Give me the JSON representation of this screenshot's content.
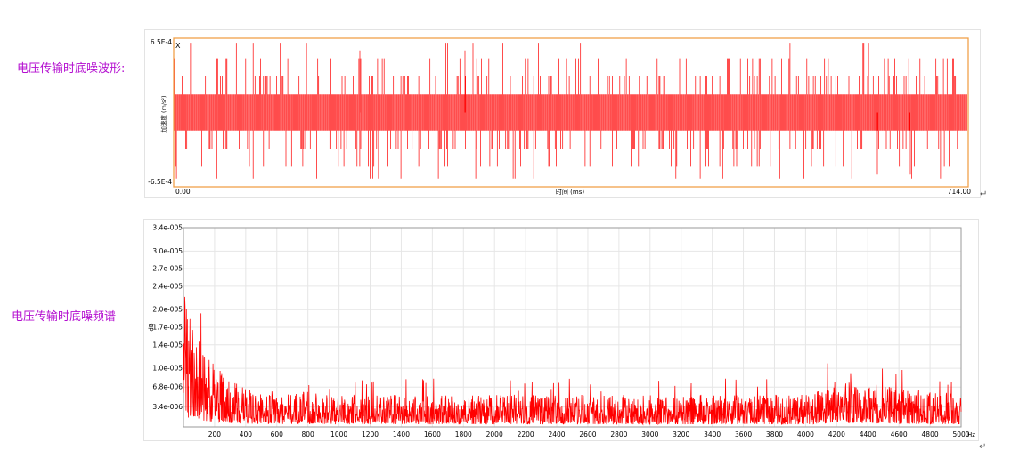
{
  "captions": {
    "waveform": "电压传输时底噪波形:",
    "spectrum": "电压传输时底噪频谱"
  },
  "return_mark": "↵",
  "colors": {
    "signal": "#ff0000",
    "waveform_frame": "#f0a14a",
    "caption": "#b40fd0",
    "grid": "#e6e6e6"
  },
  "chart_data": [
    {
      "type": "line",
      "channel_label": "X",
      "xlabel": "时间 (ms)",
      "ylabel": "加速度 (m/s²)",
      "xlim": [
        0.0,
        714.0
      ],
      "ylim": [
        -0.00065,
        0.00065
      ],
      "x_tick_labels": [
        "0.00",
        "714.00"
      ],
      "y_tick_labels": [
        "6.5E-4",
        "-6.5E-4"
      ],
      "grid": false,
      "series": [
        {
          "levels": [
            -0.00065,
            -0.00048,
            -0.00032,
            -0.00016,
            0,
            0.00016,
            0.00032,
            0.00048,
            0.00065
          ],
          "typical_range": [
            -0.00016,
            0.00016
          ],
          "peak_max": 0.00055,
          "peak_min": -0.00055
        }
      ]
    },
    {
      "type": "line",
      "xlabel": "Hz",
      "ylabel": "dB",
      "xlim": [
        0,
        5000
      ],
      "ylim": [
        0,
        3.4e-05
      ],
      "x_ticks": [
        200,
        400,
        600,
        800,
        1000,
        1200,
        1400,
        1600,
        1800,
        2000,
        2200,
        2400,
        2600,
        2800,
        3000,
        3200,
        3400,
        3600,
        3800,
        4000,
        4200,
        4400,
        4600,
        4800,
        5000
      ],
      "y_ticks": [
        3.4e-06,
        6.8e-06,
        1e-05,
        1.4e-05,
        1.7e-05,
        2e-05,
        2.4e-05,
        2.7e-05,
        3e-05,
        3.4e-05
      ],
      "y_tick_labels": [
        "3.4e-006",
        "6.8e-006",
        "1.0e-005",
        "1.4e-005",
        "1.7e-005",
        "2.0e-005",
        "2.4e-005",
        "2.7e-005",
        "3.0e-005",
        "3.4e-005"
      ],
      "grid": true,
      "series": [
        {
          "x": [
            0,
            10,
            25,
            50,
            75,
            100,
            150,
            200,
            250,
            300,
            400,
            600,
            800,
            1000,
            1500,
            2000,
            3000,
            4000,
            4200,
            5000
          ],
          "values": [
            3.2e-05,
            2.6e-05,
            2e-05,
            1.8e-05,
            1.7e-05,
            1.5e-05,
            1.2e-05,
            1.1e-05,
            9.5e-06,
            8e-06,
            6.5e-06,
            6e-06,
            6e-06,
            5.5e-06,
            5.5e-06,
            5.5e-06,
            5.5e-06,
            5.5e-06,
            8e-06,
            5.5e-06
          ]
        }
      ]
    }
  ]
}
